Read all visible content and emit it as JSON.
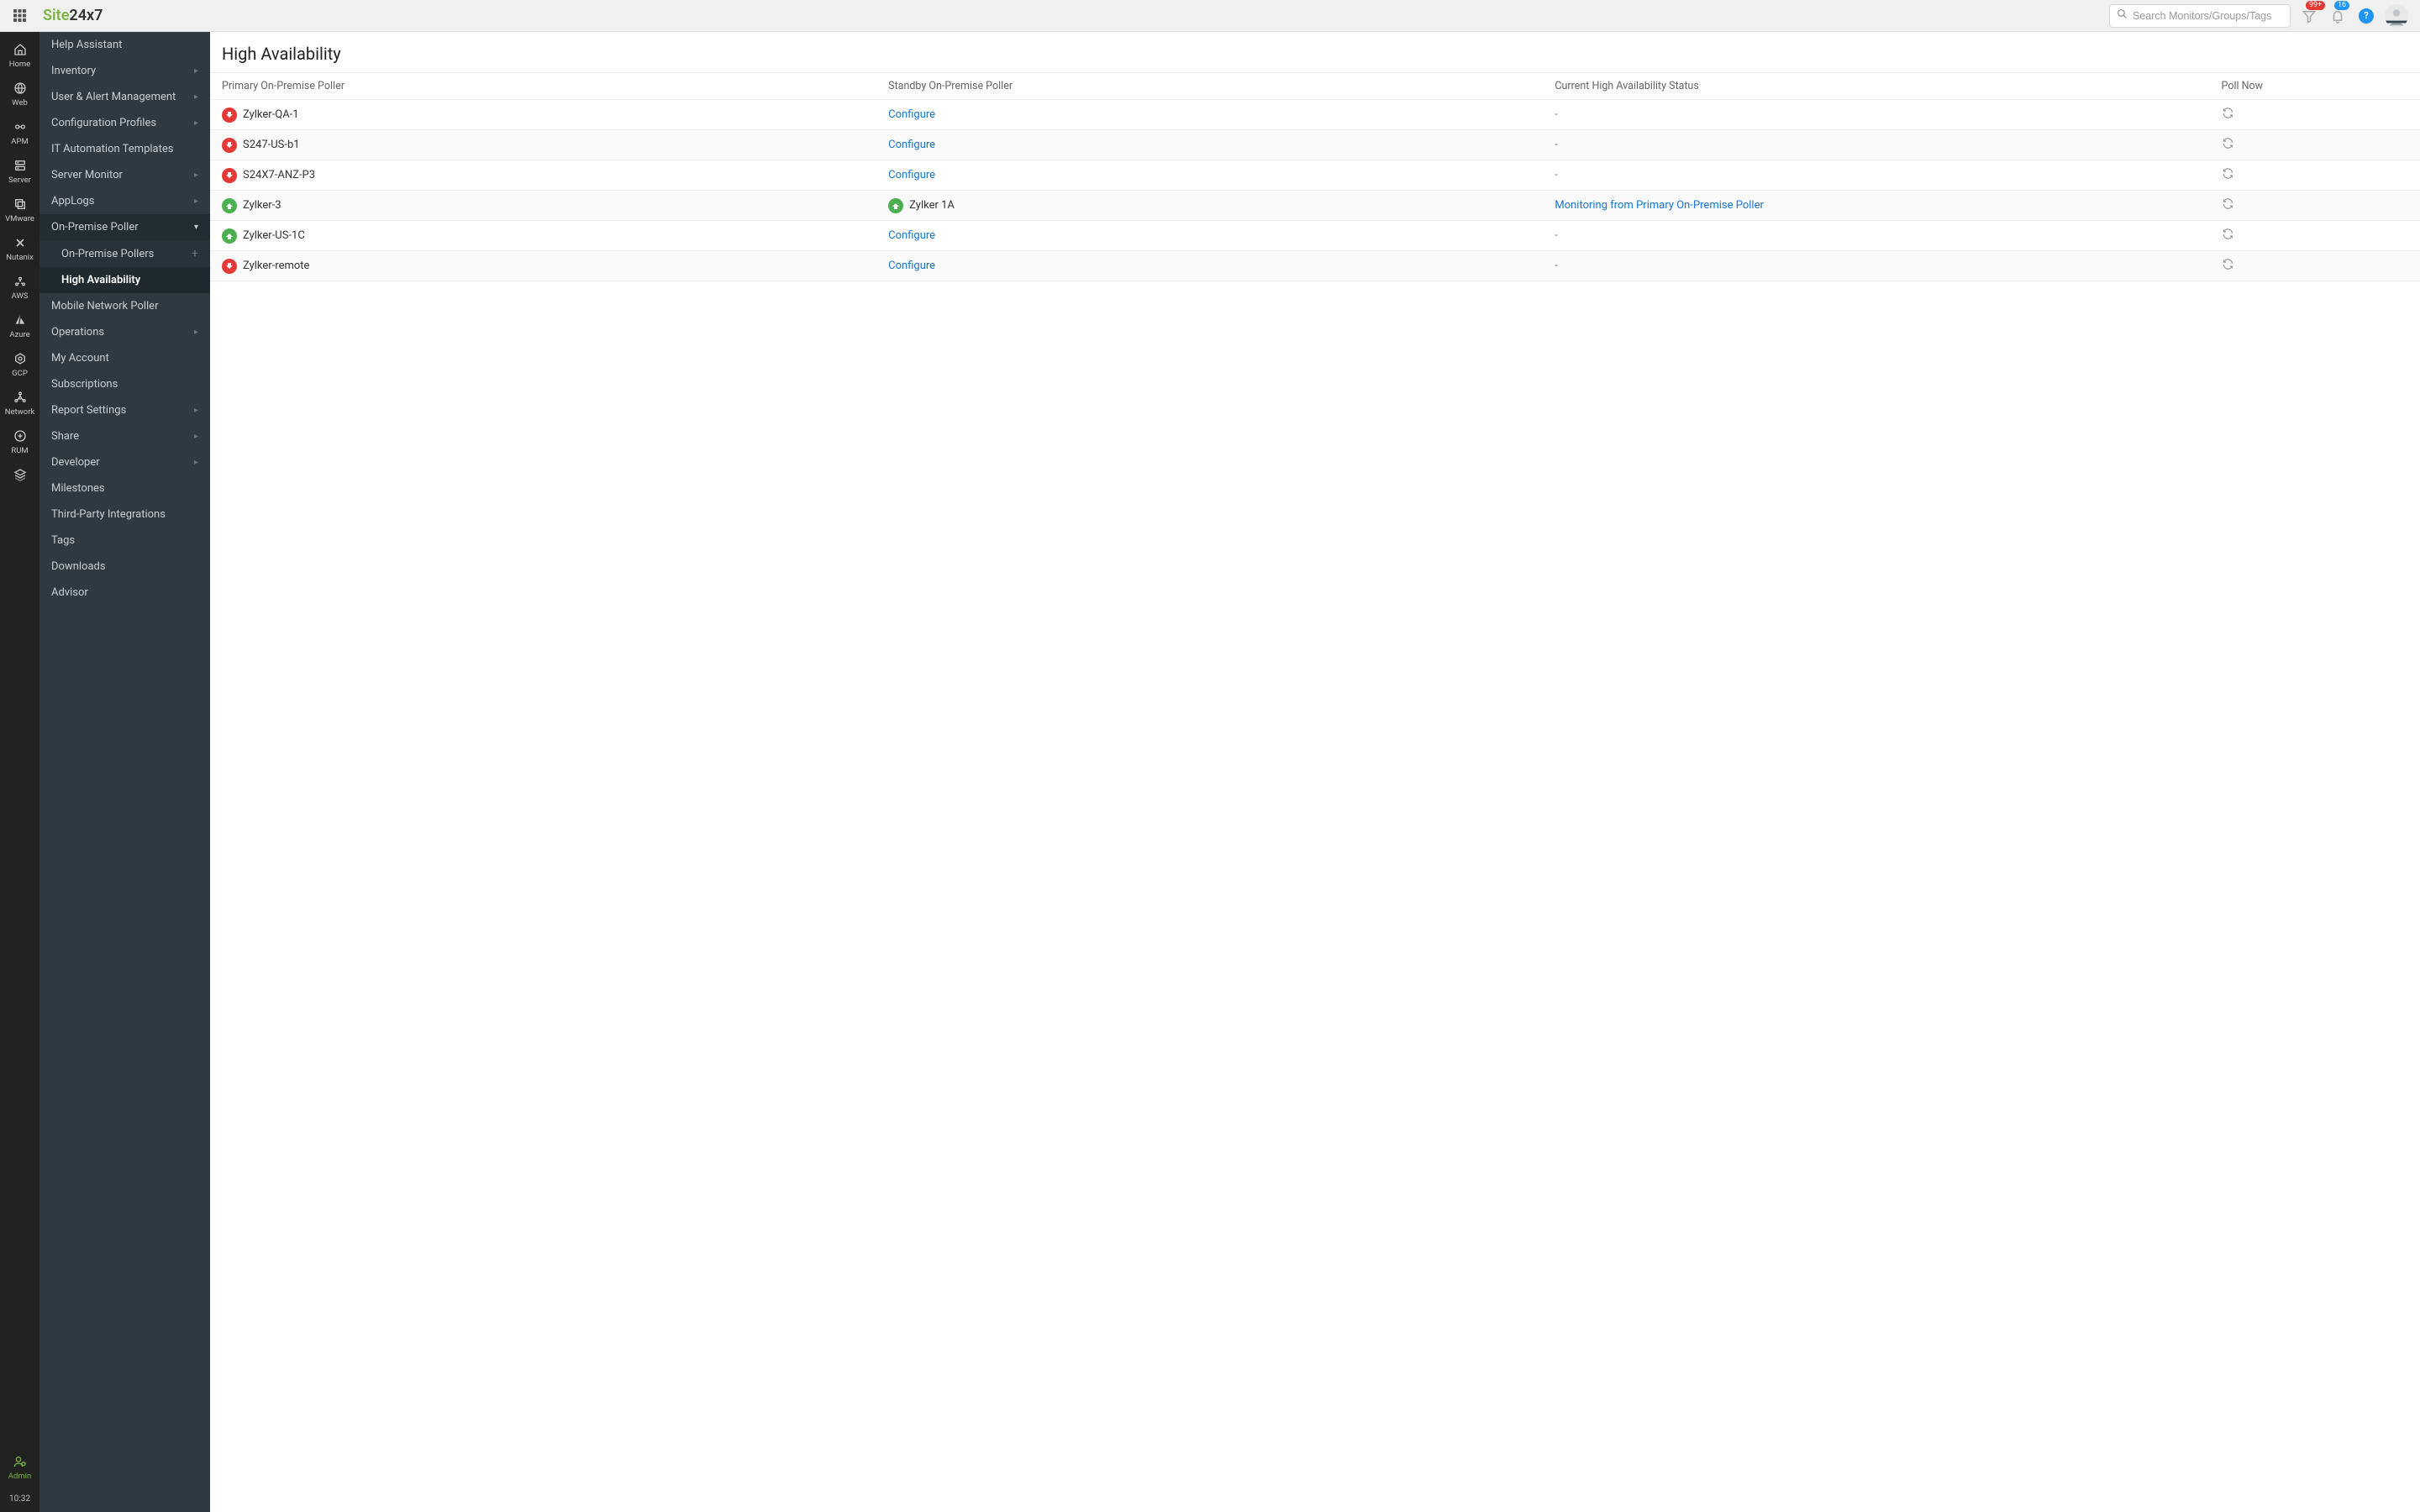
{
  "logo": {
    "part1": "Site",
    "part2": "24x7"
  },
  "search": {
    "placeholder": "Search Monitors/Groups/Tags"
  },
  "header": {
    "alert_badge": "99+",
    "notif_badge": "16"
  },
  "rail": {
    "items": [
      {
        "label": "Home",
        "icon": "home"
      },
      {
        "label": "Web",
        "icon": "globe"
      },
      {
        "label": "APM",
        "icon": "apm"
      },
      {
        "label": "Server",
        "icon": "server"
      },
      {
        "label": "VMware",
        "icon": "vmware"
      },
      {
        "label": "Nutanix",
        "icon": "nutanix"
      },
      {
        "label": "AWS",
        "icon": "aws"
      },
      {
        "label": "Azure",
        "icon": "azure"
      },
      {
        "label": "GCP",
        "icon": "gcp"
      },
      {
        "label": "Network",
        "icon": "network"
      },
      {
        "label": "RUM",
        "icon": "rum"
      },
      {
        "label": "",
        "icon": "stack"
      }
    ],
    "admin": "Admin",
    "time": "10:32"
  },
  "sidebar": {
    "items": [
      {
        "label": "Help Assistant"
      },
      {
        "label": "Inventory",
        "sub": true
      },
      {
        "label": "User & Alert Management",
        "sub": true
      },
      {
        "label": "Configuration Profiles",
        "sub": true
      },
      {
        "label": "IT Automation Templates"
      },
      {
        "label": "Server Monitor",
        "sub": true
      },
      {
        "label": "AppLogs",
        "sub": true
      },
      {
        "label": "On-Premise Poller",
        "sub": true,
        "expanded": true
      },
      {
        "label": "Mobile Network Poller"
      },
      {
        "label": "Operations",
        "sub": true
      },
      {
        "label": "My Account"
      },
      {
        "label": "Subscriptions"
      },
      {
        "label": "Report Settings",
        "sub": true
      },
      {
        "label": "Share",
        "sub": true
      },
      {
        "label": "Developer",
        "sub": true
      },
      {
        "label": "Milestones"
      },
      {
        "label": "Third-Party Integrations"
      },
      {
        "label": "Tags"
      },
      {
        "label": "Downloads"
      },
      {
        "label": "Advisor"
      }
    ],
    "onpremise_sub": [
      {
        "label": "On-Premise Pollers"
      },
      {
        "label": "High Availability",
        "active": true
      }
    ]
  },
  "page": {
    "title": "High Availability"
  },
  "table": {
    "headers": {
      "primary": "Primary On-Premise Poller",
      "standby": "Standby On-Premise Poller",
      "status": "Current High Availability Status",
      "poll": "Poll Now"
    },
    "rows": [
      {
        "primary": "Zylker-QA-1",
        "pstatus": "down",
        "standby_type": "link",
        "standby": "Configure",
        "status": "-"
      },
      {
        "primary": "S247-US-b1",
        "pstatus": "down",
        "standby_type": "link",
        "standby": "Configure",
        "status": "-"
      },
      {
        "primary": "S24X7-ANZ-P3",
        "pstatus": "down",
        "standby_type": "link",
        "standby": "Configure",
        "status": "-"
      },
      {
        "primary": "Zylker-3",
        "pstatus": "up",
        "standby_type": "poller",
        "standby": "Zylker 1A",
        "sstatus": "up",
        "status": "Monitoring from Primary On-Premise Poller",
        "status_link": true
      },
      {
        "primary": "Zylker-US-1C",
        "pstatus": "up",
        "standby_type": "link",
        "standby": "Configure",
        "status": "-"
      },
      {
        "primary": "Zylker-remote",
        "pstatus": "down",
        "standby_type": "link",
        "standby": "Configure",
        "status": "-"
      }
    ]
  }
}
